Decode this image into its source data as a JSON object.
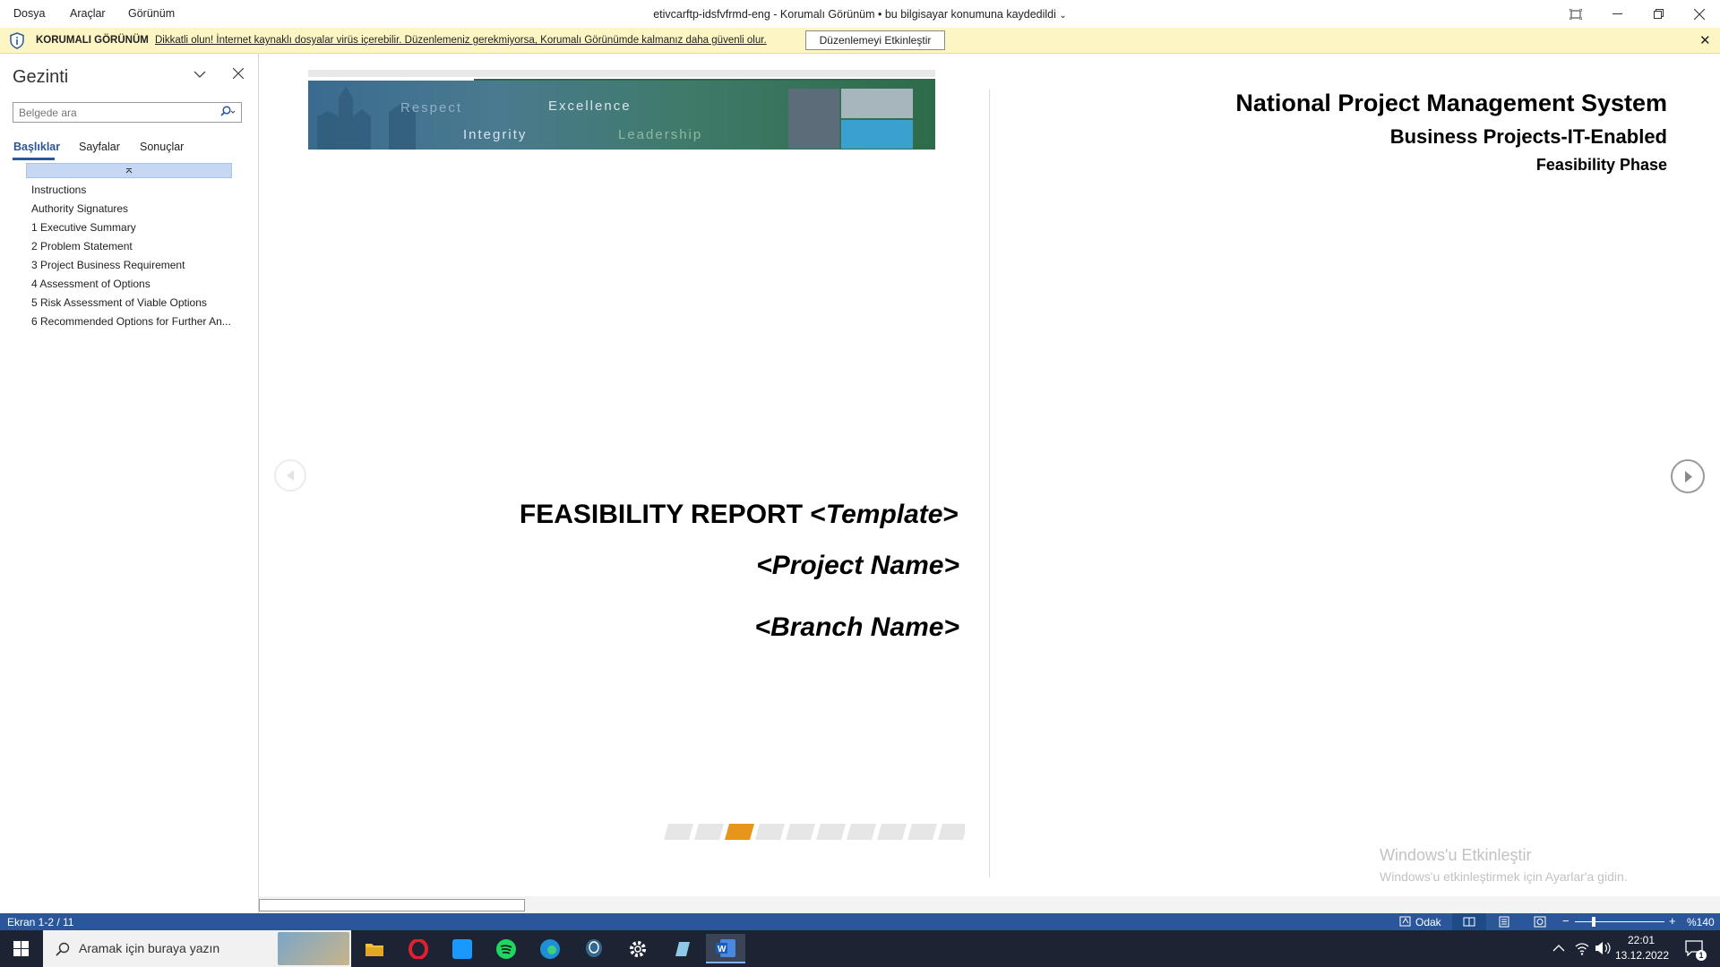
{
  "menu": {
    "file": "Dosya",
    "tools": "Araçlar",
    "view": "Görünüm"
  },
  "title": "etivcarftp-idsfvfrmd-eng  -  Korumalı Görünüm  •  bu bilgisayar konumuna kaydedildi",
  "protected": {
    "label": "KORUMALI GÖRÜNÜM",
    "message": "Dikkatli olun! İnternet kaynaklı dosyalar virüs içerebilir. Düzenlemeniz gerekmiyorsa, Korumalı Görünümde kalmanız daha güvenli olur.",
    "enable_button": "Düzenlemeyi Etkinleştir"
  },
  "nav": {
    "title": "Gezinti",
    "search_placeholder": "Belgede ara",
    "tabs": [
      "Başlıklar",
      "Sayfalar",
      "Sonuçlar"
    ],
    "headings": [
      "Instructions",
      "Authority Signatures",
      "1 Executive Summary",
      "2 Problem Statement",
      "3 Project Business Requirement",
      "4 Assessment of Options",
      "5 Risk Assessment of Viable Options",
      "6 Recommended Options for Further An..."
    ]
  },
  "banner": {
    "words": [
      "Respect",
      "Excellence",
      "Integrity",
      "Leadership"
    ]
  },
  "page_left": {
    "report_title": "FEASIBILITY REPORT <",
    "report_title_italic": "Template",
    "report_title_end": ">",
    "project_name": "<Project Name>",
    "branch_name": "<Branch Name>",
    "progress_active_index": 2
  },
  "page_right": {
    "line1": "National Project Management System",
    "line2": "Business Projects-IT-Enabled",
    "line3": "Feasibility Phase"
  },
  "watermark": {
    "line1": "Windows'u Etkinleştir",
    "line2": "Windows'u etkinleştirmek için Ayarlar'a gidin."
  },
  "status": {
    "screen": "Ekran 1-2 / 11",
    "focus": "Odak",
    "zoom": "%140"
  },
  "taskbar": {
    "search_placeholder": "Aramak için buraya yazın",
    "time": "22:01",
    "date": "13.12.2022",
    "notification_count": "1"
  },
  "colors": {
    "accent": "#2b579a",
    "banner_green": "#2e6b4a",
    "progress_active": "#e8951c",
    "info_bar": "#fdf6c4"
  }
}
